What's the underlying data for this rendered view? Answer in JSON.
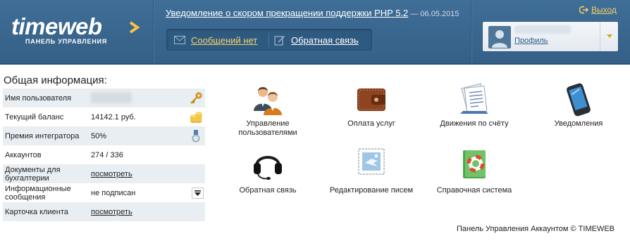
{
  "header": {
    "logo_word": "timeweb",
    "logo_subtitle": "ПАНЕЛЬ УПРАВЛЕНИЯ",
    "notice_link": "Уведомление о скором прекращении поддержки PHP 5.2",
    "notice_date": " — 06.05.2015",
    "messages_label": "Сообщений нет",
    "feedback_label": "Обратная связь",
    "logout_label": "Выход",
    "profile_label": "Профиль"
  },
  "info": {
    "title": "Общая информация:",
    "rows": [
      {
        "label": "Имя пользователя",
        "value": ""
      },
      {
        "label": "Текущий баланс",
        "value": "14142.1 руб."
      },
      {
        "label": "Премия интегратора",
        "value": "50%"
      },
      {
        "label": "Аккаунтов",
        "value": "274 / 336"
      },
      {
        "label": "Документы для бухгалтерии",
        "value": "посмотреть"
      },
      {
        "label": "Информационные сообщения",
        "value": "не подписан"
      },
      {
        "label": "Карточка клиента",
        "value": "посмотреть"
      }
    ]
  },
  "tiles": [
    {
      "label": "Управление пользователями",
      "icon": "users-icon"
    },
    {
      "label": "Оплата услуг",
      "icon": "wallet-icon"
    },
    {
      "label": "Движения по счёту",
      "icon": "documents-icon"
    },
    {
      "label": "Уведомления",
      "icon": "phone-icon"
    },
    {
      "label": "Обратная связь",
      "icon": "headset-icon"
    },
    {
      "label": "Редактирование писем",
      "icon": "letter-stamp-icon"
    },
    {
      "label": "Справочная система",
      "icon": "help-book-icon"
    }
  ],
  "footer": "Панель Управления Аккаунтом © TIMEWEB",
  "colors": {
    "header": "#3a678f",
    "accent": "#f6c343",
    "row_alt": "#e9eef3"
  }
}
